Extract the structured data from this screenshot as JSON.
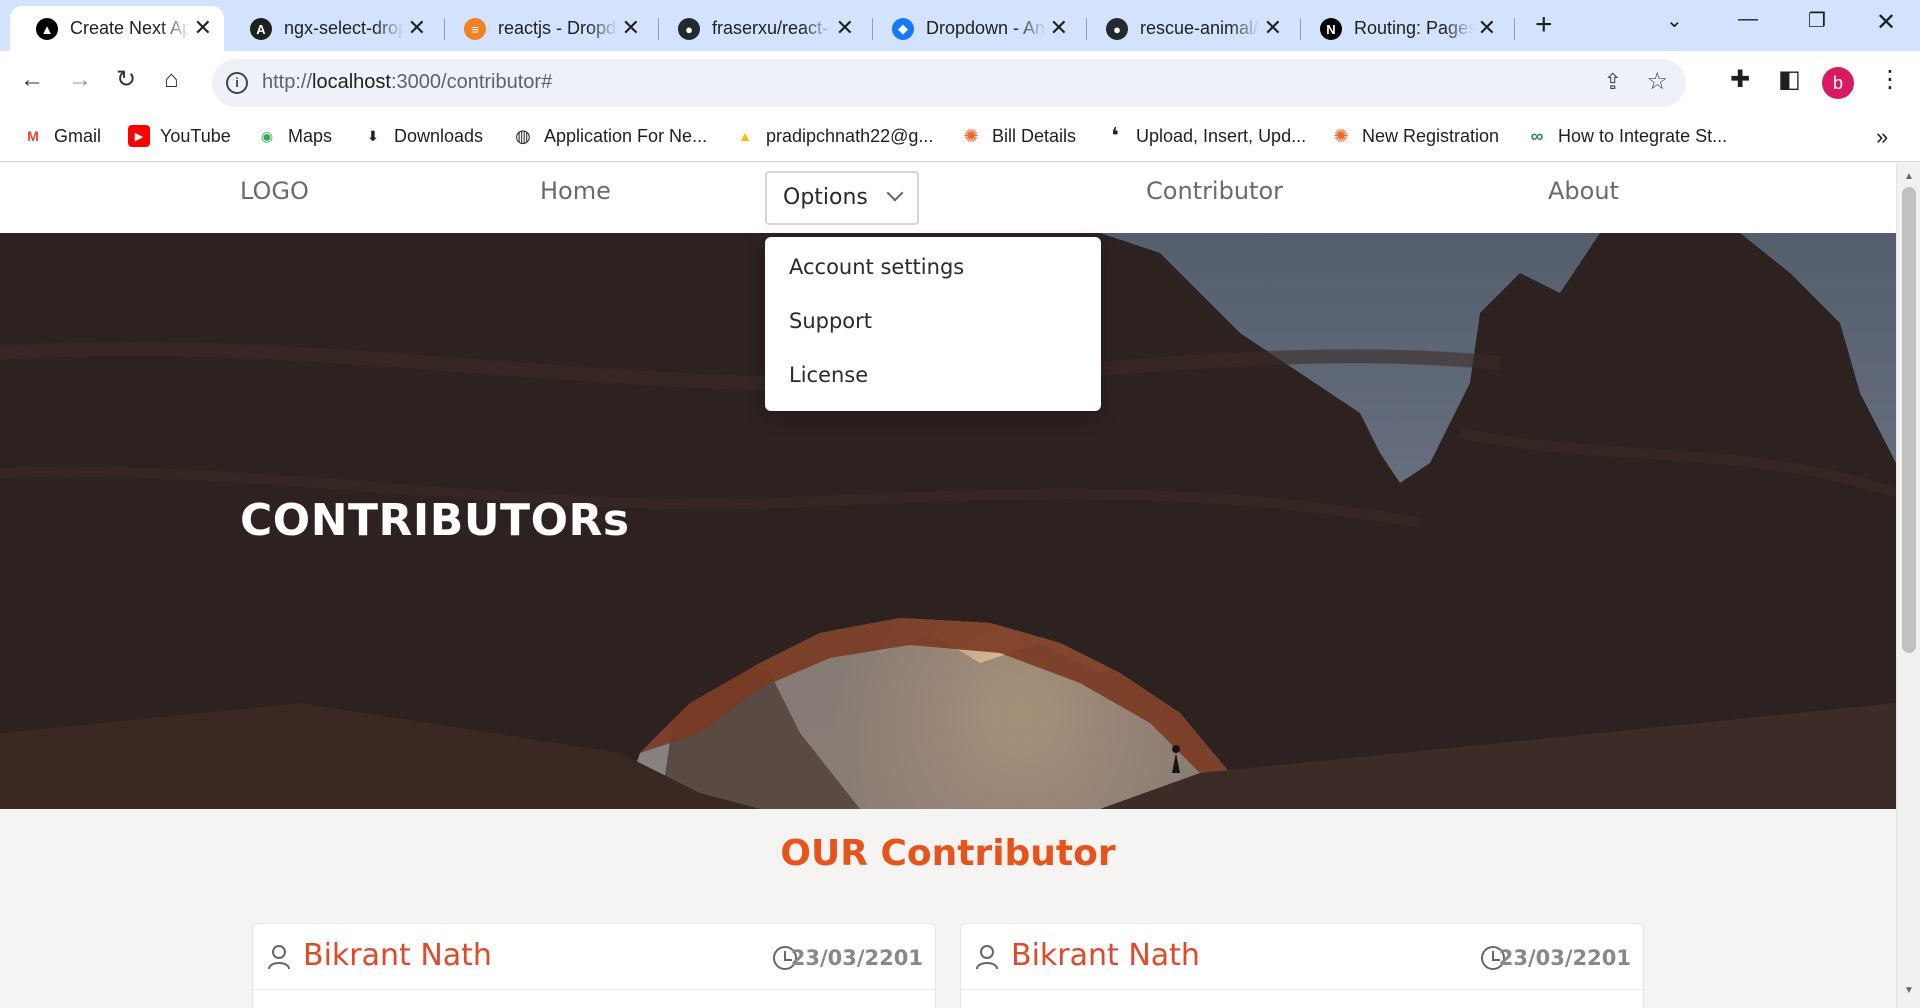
{
  "browser": {
    "tabs": [
      {
        "title": "Create Next App",
        "icon": "triangle-logo-icon",
        "color": "#000000",
        "glyph": "▲"
      },
      {
        "title": "ngx-select-dropdown",
        "icon": "angular-icon",
        "color": "#1f1f1f",
        "glyph": "A"
      },
      {
        "title": "reactjs - Dropdown",
        "icon": "stackoverflow-icon",
        "color": "#f48024",
        "glyph": "≡"
      },
      {
        "title": "fraserxu/react-",
        "icon": "github-icon",
        "color": "#24292f",
        "glyph": "●"
      },
      {
        "title": "Dropdown - Ant",
        "icon": "antd-icon",
        "color": "#1677ff",
        "glyph": "◆"
      },
      {
        "title": "rescue-animal/",
        "icon": "github-icon",
        "color": "#24292f",
        "glyph": "●"
      },
      {
        "title": "Routing: Pages",
        "icon": "nextjs-icon",
        "color": "#000000",
        "glyph": "N"
      }
    ],
    "url_prefix": "http://",
    "url_host": "localhost",
    "url_rest": ":3000/contributor#",
    "profile_initial": "b",
    "bookmarks": [
      {
        "label": "Gmail",
        "icon": "gmail-icon",
        "color": "#ea4335",
        "glyph": "M"
      },
      {
        "label": "YouTube",
        "icon": "youtube-icon",
        "color": "#ff0000",
        "glyph": "▶"
      },
      {
        "label": "Maps",
        "icon": "maps-icon",
        "color": "#34a853",
        "glyph": "◉"
      },
      {
        "label": "Downloads",
        "icon": "download-icon",
        "color": "#1f1f1f",
        "glyph": "⬇"
      },
      {
        "label": "Application For Ne...",
        "icon": "globe-icon",
        "color": "#1f1f1f",
        "glyph": "◍"
      },
      {
        "label": "pradipchnath22@g...",
        "icon": "google-drive-icon",
        "color": "#fbbc04",
        "glyph": "▲"
      },
      {
        "label": "Bill Details",
        "icon": "sun-logo-icon",
        "color": "#f26522",
        "glyph": "✺"
      },
      {
        "label": "Upload, Insert, Upd...",
        "icon": "quote-logo-icon",
        "color": "#1f1f1f",
        "glyph": "❛"
      },
      {
        "label": "New Registration",
        "icon": "sun-logo-icon",
        "color": "#f26522",
        "glyph": "✺"
      },
      {
        "label": "How to Integrate St...",
        "icon": "link-logo-icon",
        "color": "#2e8b57",
        "glyph": "∞"
      }
    ]
  },
  "site": {
    "nav": {
      "logo": "LOGO",
      "home": "Home",
      "options": "Options",
      "contributor": "Contributor",
      "about": "About"
    },
    "dropdown": [
      "Account settings",
      "Support",
      "License"
    ],
    "hero_title": "CONTRIBUTORs",
    "section_title": "OUR Contributor",
    "cards": [
      {
        "name": "Bikrant Nath",
        "date": "23/03/2201"
      },
      {
        "name": "Bikrant Nath",
        "date": "23/03/2201"
      }
    ]
  },
  "colors": {
    "accent_orange": "#e6541c",
    "name_red": "#e04a28",
    "tabbar": "#d3e3fd"
  }
}
